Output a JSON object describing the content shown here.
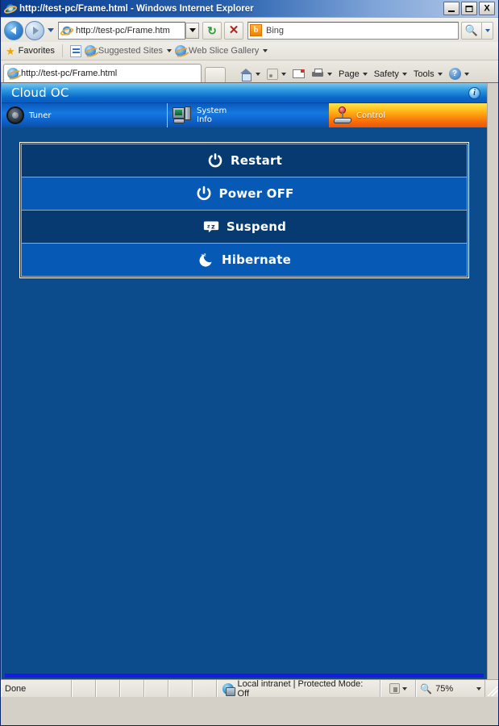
{
  "browser": {
    "title": "http://test-pc/Frame.html - Windows Internet Explorer",
    "window_controls": {
      "minimize": "_",
      "maximize": "□",
      "close": "X"
    },
    "address": {
      "url": "http://test-pc/Frame.htm",
      "url_host": "test-pc",
      "icon": "page-icon"
    },
    "nav": {
      "back": "back-arrow",
      "forward": "forward-arrow",
      "recent": "recent-pages-caret"
    },
    "refresh_label": "↻",
    "stop_label": "✕",
    "search": {
      "provider": "Bing",
      "placeholder": "Bing",
      "go": "🔍"
    },
    "favorites_bar": {
      "favorites_label": "Favorites",
      "items": [
        {
          "label": "Suggested Sites",
          "icon": "ie-icon"
        },
        {
          "label": "Web Slice Gallery",
          "icon": "ie-icon"
        }
      ]
    },
    "tab": {
      "label": "http://test-pc/Frame.html",
      "icon": "ie-icon"
    },
    "command_bar": [
      {
        "label": "",
        "icon": "home-icon"
      },
      {
        "label": "",
        "icon": "feeds-icon"
      },
      {
        "label": "",
        "icon": "mail-icon"
      },
      {
        "label": "",
        "icon": "print-icon"
      },
      {
        "label": "Page",
        "icon": ""
      },
      {
        "label": "Safety",
        "icon": ""
      },
      {
        "label": "Tools",
        "icon": ""
      },
      {
        "label": "",
        "icon": "help-icon"
      }
    ],
    "status_bar": {
      "status": "Done",
      "zone": "Local intranet | Protected Mode: Off",
      "zoom": "75%"
    }
  },
  "app": {
    "header": {
      "title": "Cloud OC",
      "info_icon": "info-icon"
    },
    "tabs": [
      {
        "id": "tuner",
        "label_line1": "Tuner",
        "label_line2": "",
        "icon": "steering-wheel-icon",
        "active": false
      },
      {
        "id": "system-info",
        "label_line1": "System",
        "label_line2": "Info",
        "icon": "computer-icon",
        "active": false
      },
      {
        "id": "control",
        "label_line1": "Control",
        "label_line2": "",
        "icon": "joystick-icon",
        "active": true
      }
    ],
    "power_buttons": [
      {
        "id": "restart",
        "label": "Restart",
        "icon": "restart-icon",
        "style": "dark"
      },
      {
        "id": "power-off",
        "label": "Power OFF",
        "icon": "power-icon",
        "style": "light"
      },
      {
        "id": "suspend",
        "label": "Suspend",
        "icon": "suspend-icon",
        "style": "dark"
      },
      {
        "id": "hibernate",
        "label": "Hibernate",
        "icon": "hibernate-icon",
        "style": "light"
      }
    ],
    "colors": {
      "page_bg": "#0d4c8c",
      "btn_dark": "#073a71",
      "btn_light": "#0659b4",
      "tab_active_accent": "#f96f0a",
      "footer_bar": "#1919e6"
    }
  }
}
